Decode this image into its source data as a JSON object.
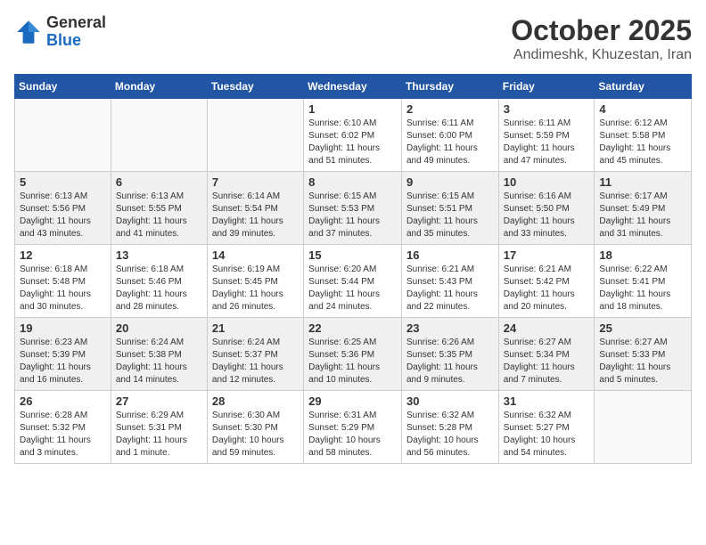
{
  "logo": {
    "general": "General",
    "blue": "Blue"
  },
  "header": {
    "month": "October 2025",
    "location": "Andimeshk, Khuzestan, Iran"
  },
  "weekdays": [
    "Sunday",
    "Monday",
    "Tuesday",
    "Wednesday",
    "Thursday",
    "Friday",
    "Saturday"
  ],
  "weeks": [
    [
      {
        "day": "",
        "info": ""
      },
      {
        "day": "",
        "info": ""
      },
      {
        "day": "",
        "info": ""
      },
      {
        "day": "1",
        "info": "Sunrise: 6:10 AM\nSunset: 6:02 PM\nDaylight: 11 hours\nand 51 minutes."
      },
      {
        "day": "2",
        "info": "Sunrise: 6:11 AM\nSunset: 6:00 PM\nDaylight: 11 hours\nand 49 minutes."
      },
      {
        "day": "3",
        "info": "Sunrise: 6:11 AM\nSunset: 5:59 PM\nDaylight: 11 hours\nand 47 minutes."
      },
      {
        "day": "4",
        "info": "Sunrise: 6:12 AM\nSunset: 5:58 PM\nDaylight: 11 hours\nand 45 minutes."
      }
    ],
    [
      {
        "day": "5",
        "info": "Sunrise: 6:13 AM\nSunset: 5:56 PM\nDaylight: 11 hours\nand 43 minutes."
      },
      {
        "day": "6",
        "info": "Sunrise: 6:13 AM\nSunset: 5:55 PM\nDaylight: 11 hours\nand 41 minutes."
      },
      {
        "day": "7",
        "info": "Sunrise: 6:14 AM\nSunset: 5:54 PM\nDaylight: 11 hours\nand 39 minutes."
      },
      {
        "day": "8",
        "info": "Sunrise: 6:15 AM\nSunset: 5:53 PM\nDaylight: 11 hours\nand 37 minutes."
      },
      {
        "day": "9",
        "info": "Sunrise: 6:15 AM\nSunset: 5:51 PM\nDaylight: 11 hours\nand 35 minutes."
      },
      {
        "day": "10",
        "info": "Sunrise: 6:16 AM\nSunset: 5:50 PM\nDaylight: 11 hours\nand 33 minutes."
      },
      {
        "day": "11",
        "info": "Sunrise: 6:17 AM\nSunset: 5:49 PM\nDaylight: 11 hours\nand 31 minutes."
      }
    ],
    [
      {
        "day": "12",
        "info": "Sunrise: 6:18 AM\nSunset: 5:48 PM\nDaylight: 11 hours\nand 30 minutes."
      },
      {
        "day": "13",
        "info": "Sunrise: 6:18 AM\nSunset: 5:46 PM\nDaylight: 11 hours\nand 28 minutes."
      },
      {
        "day": "14",
        "info": "Sunrise: 6:19 AM\nSunset: 5:45 PM\nDaylight: 11 hours\nand 26 minutes."
      },
      {
        "day": "15",
        "info": "Sunrise: 6:20 AM\nSunset: 5:44 PM\nDaylight: 11 hours\nand 24 minutes."
      },
      {
        "day": "16",
        "info": "Sunrise: 6:21 AM\nSunset: 5:43 PM\nDaylight: 11 hours\nand 22 minutes."
      },
      {
        "day": "17",
        "info": "Sunrise: 6:21 AM\nSunset: 5:42 PM\nDaylight: 11 hours\nand 20 minutes."
      },
      {
        "day": "18",
        "info": "Sunrise: 6:22 AM\nSunset: 5:41 PM\nDaylight: 11 hours\nand 18 minutes."
      }
    ],
    [
      {
        "day": "19",
        "info": "Sunrise: 6:23 AM\nSunset: 5:39 PM\nDaylight: 11 hours\nand 16 minutes."
      },
      {
        "day": "20",
        "info": "Sunrise: 6:24 AM\nSunset: 5:38 PM\nDaylight: 11 hours\nand 14 minutes."
      },
      {
        "day": "21",
        "info": "Sunrise: 6:24 AM\nSunset: 5:37 PM\nDaylight: 11 hours\nand 12 minutes."
      },
      {
        "day": "22",
        "info": "Sunrise: 6:25 AM\nSunset: 5:36 PM\nDaylight: 11 hours\nand 10 minutes."
      },
      {
        "day": "23",
        "info": "Sunrise: 6:26 AM\nSunset: 5:35 PM\nDaylight: 11 hours\nand 9 minutes."
      },
      {
        "day": "24",
        "info": "Sunrise: 6:27 AM\nSunset: 5:34 PM\nDaylight: 11 hours\nand 7 minutes."
      },
      {
        "day": "25",
        "info": "Sunrise: 6:27 AM\nSunset: 5:33 PM\nDaylight: 11 hours\nand 5 minutes."
      }
    ],
    [
      {
        "day": "26",
        "info": "Sunrise: 6:28 AM\nSunset: 5:32 PM\nDaylight: 11 hours\nand 3 minutes."
      },
      {
        "day": "27",
        "info": "Sunrise: 6:29 AM\nSunset: 5:31 PM\nDaylight: 11 hours\nand 1 minute."
      },
      {
        "day": "28",
        "info": "Sunrise: 6:30 AM\nSunset: 5:30 PM\nDaylight: 10 hours\nand 59 minutes."
      },
      {
        "day": "29",
        "info": "Sunrise: 6:31 AM\nSunset: 5:29 PM\nDaylight: 10 hours\nand 58 minutes."
      },
      {
        "day": "30",
        "info": "Sunrise: 6:32 AM\nSunset: 5:28 PM\nDaylight: 10 hours\nand 56 minutes."
      },
      {
        "day": "31",
        "info": "Sunrise: 6:32 AM\nSunset: 5:27 PM\nDaylight: 10 hours\nand 54 minutes."
      },
      {
        "day": "",
        "info": ""
      }
    ]
  ]
}
